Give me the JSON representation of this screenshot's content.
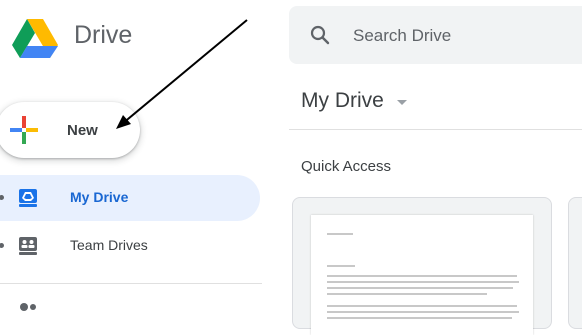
{
  "app": {
    "name": "Drive"
  },
  "sidebar": {
    "new_button_label": "New",
    "items": [
      {
        "label": "My Drive",
        "icon": "my-drive-icon",
        "active": true
      },
      {
        "label": "Team Drives",
        "icon": "team-drives-icon",
        "active": false
      }
    ]
  },
  "search": {
    "placeholder": "Search Drive"
  },
  "main": {
    "title": "My Drive",
    "section_label": "Quick Access"
  },
  "colors": {
    "accent": "#1967d2",
    "active_bg": "#e8f0fe",
    "search_bg": "#f1f3f4"
  }
}
